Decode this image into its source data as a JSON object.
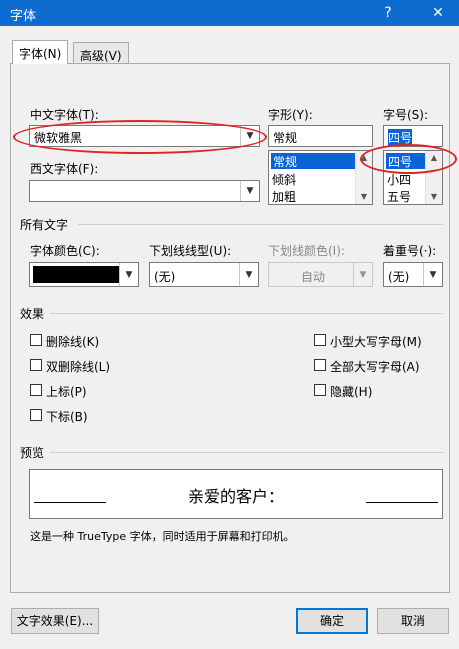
{
  "window": {
    "title": "字体",
    "help": "?",
    "close": "✕"
  },
  "tabs": [
    {
      "label": "字体(N)"
    },
    {
      "label": "高级(V)"
    }
  ],
  "font": {
    "chinese_label": "中文字体(T):",
    "chinese_value": "微软雅黑",
    "western_label": "西文字体(F):",
    "western_value": "",
    "style_label": "字形(Y):",
    "style_value": "常规",
    "style_items": [
      "常规",
      "倾斜",
      "加粗"
    ],
    "size_label": "字号(S):",
    "size_value": "四号",
    "size_items": [
      "四号",
      "小四",
      "五号"
    ]
  },
  "all_text": {
    "section": "所有文字",
    "color_label": "字体颜色(C):",
    "color_value": "#000000",
    "underline_label": "下划线线型(U):",
    "underline_value": "(无)",
    "underline_color_label": "下划线颜色(I):",
    "underline_color_value": "自动",
    "emphasis_label": "着重号(·):",
    "emphasis_value": "(无)"
  },
  "effects": {
    "section": "效果",
    "left": [
      "删除线(K)",
      "双删除线(L)",
      "上标(P)",
      "下标(B)"
    ],
    "right": [
      "小型大写字母(M)",
      "全部大写字母(A)",
      "隐藏(H)"
    ]
  },
  "preview": {
    "section": "预览",
    "sample": "亲爱的客户：",
    "note": "这是一种 TrueType 字体，同时适用于屏幕和打印机。"
  },
  "buttons": {
    "text_effects": "文字效果(E)...",
    "ok": "确定",
    "cancel": "取消"
  },
  "colors": {
    "titlebar": "#0f6ccf",
    "selection": "#0a64d8",
    "highlight_ellipse": "#e02424"
  }
}
